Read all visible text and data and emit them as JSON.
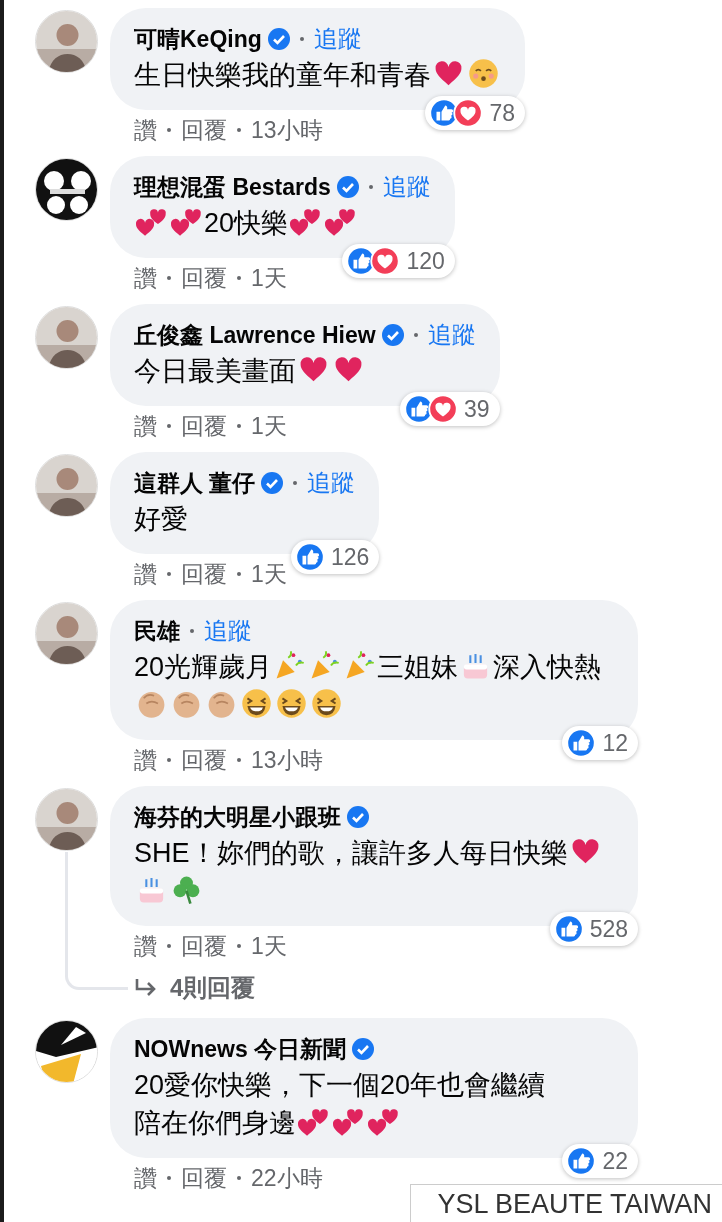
{
  "comments": [
    {
      "avatar": {
        "kind": "photo"
      },
      "name": "可晴KeQing",
      "verified": true,
      "follow": "追蹤",
      "body": [
        {
          "kind": "text",
          "text": "生日快樂我的童年和青春"
        },
        {
          "kind": "heart"
        },
        {
          "kind": "kiss"
        }
      ],
      "reactions": {
        "icons": [
          {
            "kind": "like"
          },
          {
            "kind": "love"
          }
        ],
        "count": "78"
      },
      "actions": [
        "讚",
        "回覆",
        "13小時"
      ]
    },
    {
      "avatar": {
        "kind": "sketch"
      },
      "name": "理想混蛋 Bestards",
      "verified": true,
      "follow": "追蹤",
      "body": [
        {
          "kind": "two-hearts"
        },
        {
          "kind": "two-hearts"
        },
        {
          "kind": "text",
          "text": "20快樂"
        },
        {
          "kind": "two-hearts"
        },
        {
          "kind": "two-hearts"
        }
      ],
      "reactions": {
        "icons": [
          {
            "kind": "like"
          },
          {
            "kind": "love"
          }
        ],
        "count": "120"
      },
      "actions": [
        "讚",
        "回覆",
        "1天"
      ]
    },
    {
      "avatar": {
        "kind": "photo"
      },
      "name": "丘俊鑫 Lawrence Hiew",
      "verified": true,
      "follow": "追蹤",
      "body": [
        {
          "kind": "text",
          "text": "今日最美畫面"
        },
        {
          "kind": "heart"
        },
        {
          "kind": "heart"
        }
      ],
      "reactions": {
        "icons": [
          {
            "kind": "like"
          },
          {
            "kind": "love"
          }
        ],
        "count": "39"
      },
      "actions": [
        "讚",
        "回覆",
        "1天"
      ]
    },
    {
      "avatar": {
        "kind": "photo"
      },
      "name": "這群人 董仔",
      "verified": true,
      "follow": "追蹤",
      "body": [
        {
          "kind": "text",
          "text": "好愛"
        }
      ],
      "reactions": {
        "icons": [
          {
            "kind": "like"
          }
        ],
        "count": "126"
      },
      "actions": [
        "讚",
        "回覆",
        "1天"
      ]
    },
    {
      "avatar": {
        "kind": "photo"
      },
      "name": "民雄",
      "verified": false,
      "follow": "追蹤",
      "body": [
        {
          "kind": "text",
          "text": "20光輝歲月"
        },
        {
          "kind": "popper"
        },
        {
          "kind": "popper"
        },
        {
          "kind": "popper"
        },
        {
          "kind": "text",
          "text": "三姐妹"
        },
        {
          "kind": "cake"
        },
        {
          "kind": "text",
          "text": "深入"
        },
        {
          "kind": "text",
          "text": "快熱"
        },
        {
          "kind": "clap"
        },
        {
          "kind": "clap"
        },
        {
          "kind": "clap"
        },
        {
          "kind": "laugh"
        },
        {
          "kind": "laugh"
        },
        {
          "kind": "laugh"
        }
      ],
      "reactions": {
        "icons": [
          {
            "kind": "like"
          }
        ],
        "count": "12"
      },
      "actions": [
        "讚",
        "回覆",
        "13小時"
      ]
    },
    {
      "avatar": {
        "kind": "photo"
      },
      "name": "海芬的大明星小跟班",
      "verified": true,
      "body": [
        {
          "kind": "text",
          "text": "SHE！妳們的歌，讓許多人每日快"
        },
        {
          "kind": "text",
          "text": "樂"
        },
        {
          "kind": "heart"
        },
        {
          "kind": "cake"
        },
        {
          "kind": "clover"
        }
      ],
      "reactions": {
        "icons": [
          {
            "kind": "like"
          }
        ],
        "count": "528"
      },
      "actions": [
        "讚",
        "回覆",
        "1天"
      ],
      "replies": "4則回覆"
    },
    {
      "avatar": {
        "kind": "logo"
      },
      "name": "NOWnews 今日新聞",
      "verified": true,
      "body": [
        {
          "kind": "text",
          "text": "20愛你快樂，下一個20年也會繼續"
        },
        {
          "kind": "text",
          "text": "陪在你們身邊"
        },
        {
          "kind": "two-hearts"
        },
        {
          "kind": "two-hearts"
        },
        {
          "kind": "two-hearts"
        }
      ],
      "reactions": {
        "icons": [
          {
            "kind": "like"
          }
        ],
        "count": "22"
      },
      "actions": [
        "讚",
        "回覆",
        "22小時"
      ]
    }
  ],
  "page_tag": "YSL BEAUTE TAIWAN"
}
